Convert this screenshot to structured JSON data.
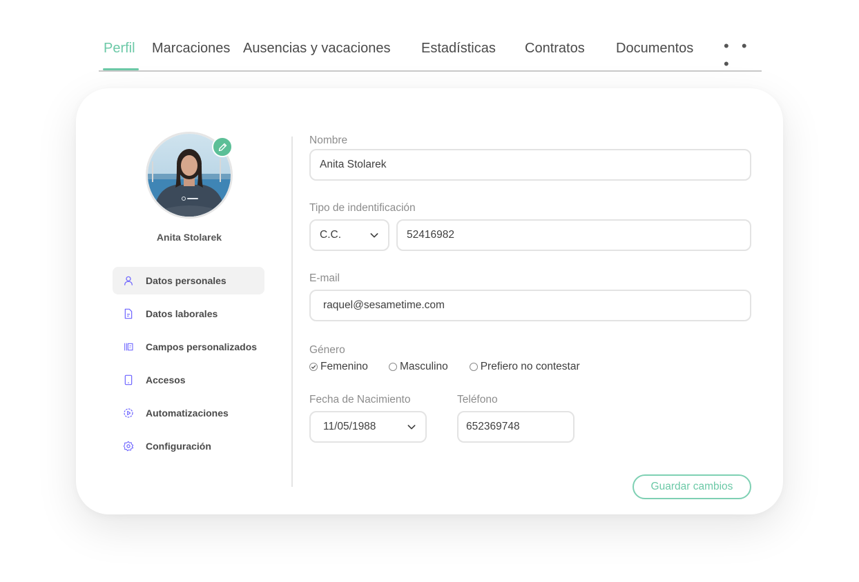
{
  "tabs": [
    {
      "label": "Perfil",
      "active": true
    },
    {
      "label": "Marcaciones"
    },
    {
      "label": "Ausencias y vacaciones"
    },
    {
      "label": "Estadísticas"
    },
    {
      "label": "Contratos"
    },
    {
      "label": "Documentos"
    }
  ],
  "more_label": "• • •",
  "accent_color": "#6cc9a7",
  "nav_icon_color": "#6c63ff",
  "profile": {
    "name": "Anita Stolarek",
    "avatar_icon": "user-photo",
    "edit_icon": "pencil-icon"
  },
  "side_nav": [
    {
      "label": "Datos personales",
      "icon": "user-icon",
      "active": true
    },
    {
      "label": "Datos laborales",
      "icon": "document-icon"
    },
    {
      "label": "Campos personalizados",
      "icon": "custom-fields-icon"
    },
    {
      "label": "Accesos",
      "icon": "device-icon"
    },
    {
      "label": "Automatizaciones",
      "icon": "automation-icon"
    },
    {
      "label": "Configuración",
      "icon": "gear-icon"
    }
  ],
  "form": {
    "nombre": {
      "label": "Nombre",
      "value": "Anita Stolarek"
    },
    "identificacion": {
      "label": "Tipo de indentificación",
      "type": "C.C.",
      "number": "52416982"
    },
    "email": {
      "label": "E-mail",
      "value": "raquel@sesametime.com"
    },
    "genero": {
      "label": "Género",
      "options": [
        "Femenino",
        "Masculino",
        "Prefiero no contestar"
      ],
      "selected": "Femenino"
    },
    "fecha": {
      "label": "Fecha de Nacimiento",
      "value": "11/05/1988"
    },
    "telefono": {
      "label": "Teléfono",
      "value": "652369748"
    },
    "save_label": "Guardar cambios"
  }
}
